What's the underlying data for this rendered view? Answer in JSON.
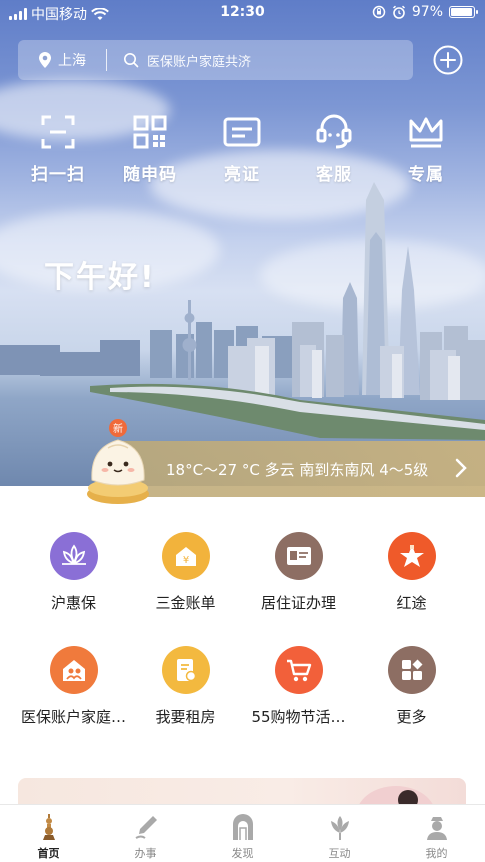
{
  "status_bar": {
    "carrier": "中国移动",
    "time": "12:30",
    "battery": "97%",
    "battery_level": 0.97
  },
  "header": {
    "city": "上海",
    "search_placeholder": "医保账户家庭共济"
  },
  "quick_actions": [
    {
      "label": "扫一扫",
      "icon": "scan-icon"
    },
    {
      "label": "随申码",
      "icon": "qr-code-icon"
    },
    {
      "label": "亮证",
      "icon": "id-card-icon"
    },
    {
      "label": "客服",
      "icon": "customer-service-icon"
    },
    {
      "label": "专属",
      "icon": "crown-icon"
    }
  ],
  "greeting": "下午好!",
  "weather": {
    "text": "18°C～27 °C 多云 南到东南风 4～5级",
    "badge": "新"
  },
  "services": [
    {
      "label": "沪惠保",
      "icon": "lotus-icon",
      "color": "#8a6fd6"
    },
    {
      "label": "三金账单",
      "icon": "yuan-house-icon",
      "color": "#f2b33c"
    },
    {
      "label": "居住证办理",
      "icon": "residence-card-icon",
      "color": "#8d6e63"
    },
    {
      "label": "红途",
      "icon": "red-star-icon",
      "color": "#ef5a2a"
    },
    {
      "label": "医保账户家庭…",
      "icon": "family-home-icon",
      "color": "#f07a3c"
    },
    {
      "label": "我要租房",
      "icon": "rent-document-icon",
      "color": "#f3b93f"
    },
    {
      "label": "55购物节活…",
      "icon": "shopping-cart-icon",
      "color": "#f2603a"
    },
    {
      "label": "更多",
      "icon": "more-apps-icon",
      "color": "#8d6e63"
    }
  ],
  "tabs": [
    {
      "label": "首页",
      "icon": "home-tower-icon",
      "active": true
    },
    {
      "label": "办事",
      "icon": "pen-icon",
      "active": false
    },
    {
      "label": "发现",
      "icon": "arch-icon",
      "active": false
    },
    {
      "label": "互动",
      "icon": "flower-icon",
      "active": false
    },
    {
      "label": "我的",
      "icon": "profile-icon",
      "active": false
    }
  ]
}
